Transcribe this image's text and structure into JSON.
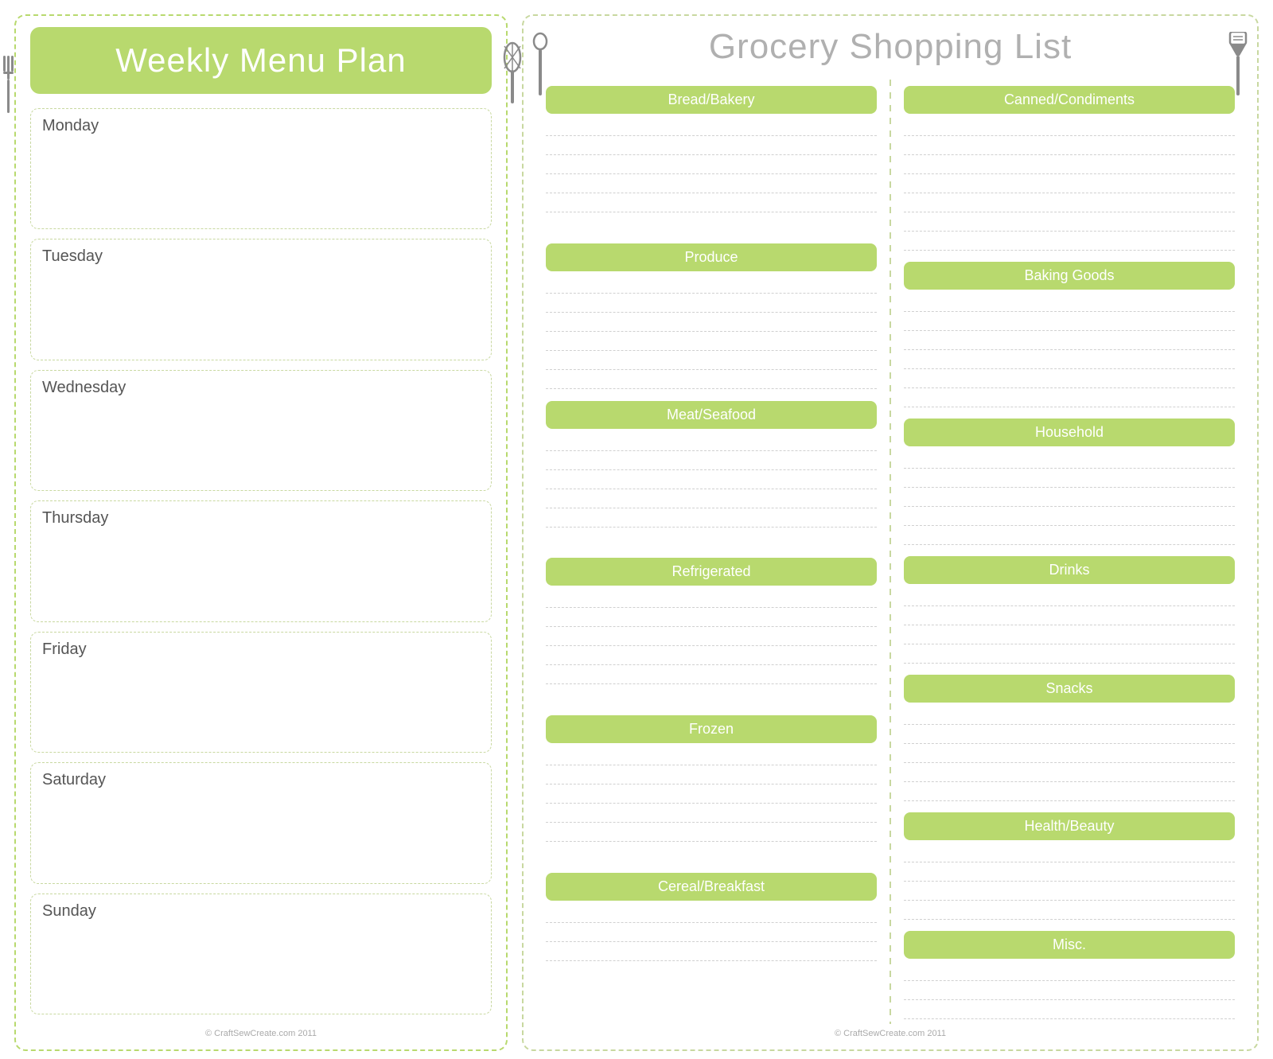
{
  "left_panel": {
    "header": "Weekly Menu Plan",
    "days": [
      "Monday",
      "Tuesday",
      "Wednesday",
      "Thursday",
      "Friday",
      "Saturday",
      "Sunday"
    ],
    "copyright": "© CraftSewCreate.com 2011"
  },
  "right_panel": {
    "header": "Grocery Shopping List",
    "col_left": {
      "categories": [
        "Bread/Bakery",
        "Produce",
        "Meat/Seafood",
        "Refrigerated",
        "Frozen",
        "Cereal/Breakfast"
      ]
    },
    "col_right": {
      "categories": [
        "Canned/Condiments",
        "Baking Goods",
        "Household",
        "Drinks",
        "Snacks",
        "Health/Beauty",
        "Misc."
      ]
    },
    "copyright": "© CraftSewCreate.com 2011"
  },
  "icons": {
    "fork": "🍴",
    "whisk": "🥄",
    "spatula": "🍳"
  }
}
